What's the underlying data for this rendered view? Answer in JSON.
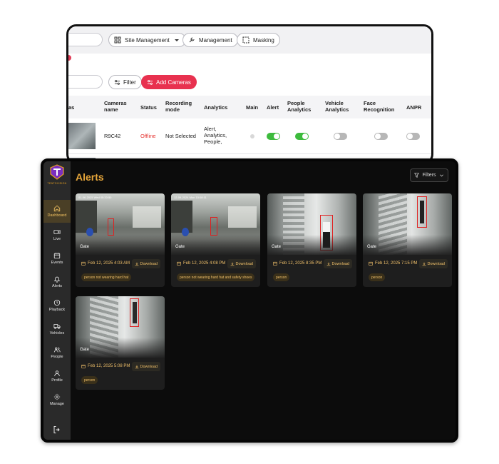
{
  "back_window": {
    "toolbar": {
      "site_management": "Site Management",
      "management": "Management",
      "masking": "Masking"
    },
    "filter_label": "Filter",
    "add_cameras_label": "Add Cameras",
    "columns": [
      "Cameras name",
      "Status",
      "Recording mode",
      "Analytics",
      "Main",
      "Alert",
      "People Analytics",
      "Vehicle Analytics",
      "Face Recognition",
      "ANPR"
    ],
    "row": {
      "camera_name": "R9C42",
      "status": "Offline",
      "recording_mode": "Not Selected",
      "analytics": "Alert, Analytics, People,",
      "main": false,
      "alert": true,
      "people_analytics": true,
      "vehicle_analytics": false,
      "face_recognition": false,
      "anpr": false
    },
    "colors": {
      "accent": "#e8314f",
      "offline": "#e5312e",
      "toggle_on": "#3dbb3d"
    }
  },
  "app": {
    "logo_text": "TENTOVISION",
    "page_title": "Alerts",
    "filters_label": "Filters",
    "nav": [
      {
        "label": "Dashboard",
        "icon": "home-icon",
        "active": true
      },
      {
        "label": "Live",
        "icon": "video-icon",
        "active": false
      },
      {
        "label": "Events",
        "icon": "calendar-icon",
        "active": false
      },
      {
        "label": "Alerts",
        "icon": "bell-icon",
        "active": false
      },
      {
        "label": "Playback",
        "icon": "clock-icon",
        "active": false
      },
      {
        "label": "Vehicles",
        "icon": "truck-icon",
        "active": false
      },
      {
        "label": "People",
        "icon": "people-icon",
        "active": false
      },
      {
        "label": "Profile",
        "icon": "user-icon",
        "active": false
      },
      {
        "label": "Manage",
        "icon": "gear-icon",
        "active": false
      }
    ],
    "download_label": "Download",
    "alerts": [
      {
        "camera": "Gate",
        "stamp": "01-06-2025 Wed 05:20:50",
        "date": "Feb 12, 2025 4:03 AM",
        "tag": "person not wearing hard hat"
      },
      {
        "camera": "Gate",
        "stamp": "12-09-2024 Mon 15:08:11",
        "date": "Feb 12, 2025 4:08 PM",
        "tag": "person not wearing hard hat and safety shoes"
      },
      {
        "camera": "Gate",
        "stamp": "",
        "date": "Feb 12, 2025 8:35 PM",
        "tag": "person"
      },
      {
        "camera": "Gate",
        "stamp": "",
        "date": "Feb 12, 2025 7:15 PM",
        "tag": "person"
      },
      {
        "camera": "Gate",
        "stamp": "",
        "date": "Feb 12, 2025 5:08 PM",
        "tag": "person"
      }
    ],
    "colors": {
      "accent": "#e6a63a",
      "background": "#0c0c0c",
      "sidebar": "#2a2a2a"
    }
  }
}
